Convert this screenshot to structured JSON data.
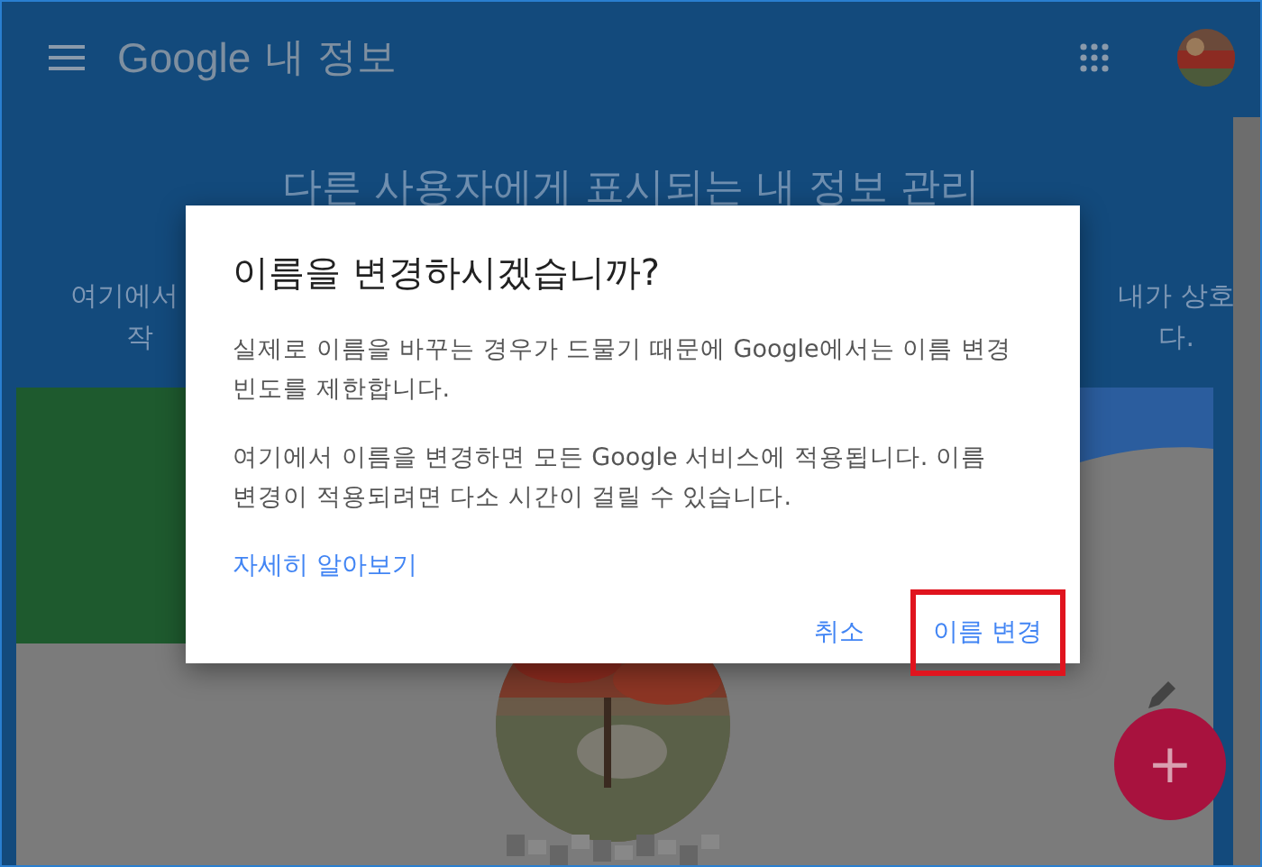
{
  "app_bar": {
    "logo": "Google",
    "title": "내 정보"
  },
  "hero": {
    "heading": "다른 사용자에게 표시되는 내 정보 관리",
    "left_lines": [
      "여기에서",
      "작"
    ],
    "right_lines": [
      "내가 상호",
      "다."
    ]
  },
  "dialog": {
    "title": "이름을 변경하시겠습니까?",
    "paragraphs": [
      "실제로 이름을 바꾸는 경우가 드물기 때문에 Google에서는 이름 변경 빈도를 제한합니다.",
      "여기에서 이름을 변경하면 모든 Google 서비스에 적용됩니다. 이름 변경이 적용되려면 다소 시간이 걸릴 수 있습니다."
    ],
    "link": "자세히 알아보기",
    "buttons": [
      {
        "label": "취소",
        "highlighted": false
      },
      {
        "label": "이름 변경",
        "highlighted": true
      }
    ]
  },
  "fab": {
    "label": "+"
  }
}
